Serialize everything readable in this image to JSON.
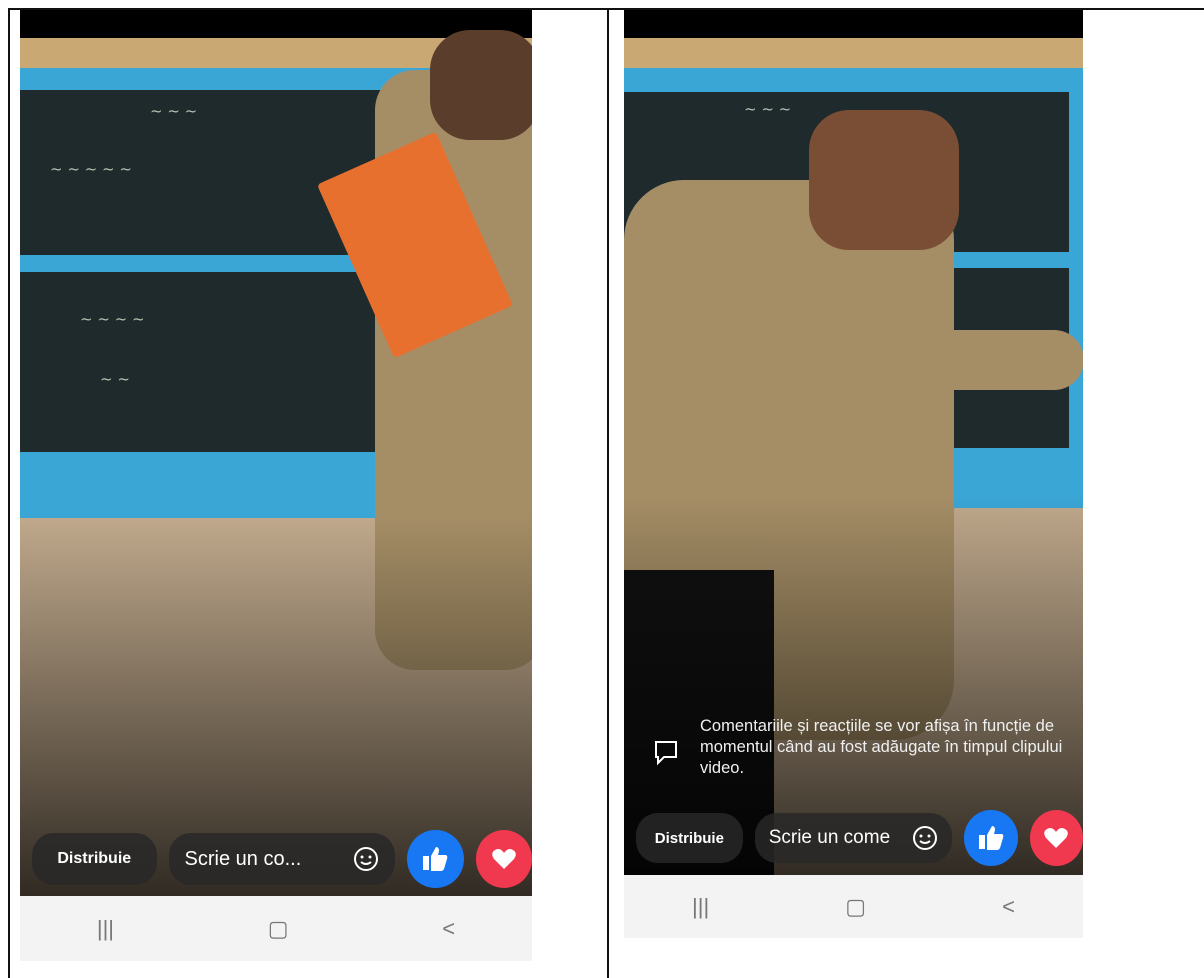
{
  "left_phone": {
    "share_label": "Distribuie",
    "comment_placeholder": "Scrie un co...",
    "nav": {
      "recents": "|||",
      "home": "▢",
      "back": "<"
    }
  },
  "right_phone": {
    "notice": "Comentariile și reacțiile se vor afișa în funcție de momentul când au fost adăugate în timpul clipului video.",
    "share_label": "Distribuie",
    "comment_placeholder": "Scrie un come",
    "nav": {
      "recents": "|||",
      "home": "▢",
      "back": "<"
    }
  },
  "colors": {
    "like": "#1877f2",
    "love": "#f0384f",
    "nav_bg": "#f3f3f3"
  },
  "icons": [
    "smiley-icon",
    "thumbs-up-icon",
    "heart-icon",
    "comment-icon"
  ]
}
